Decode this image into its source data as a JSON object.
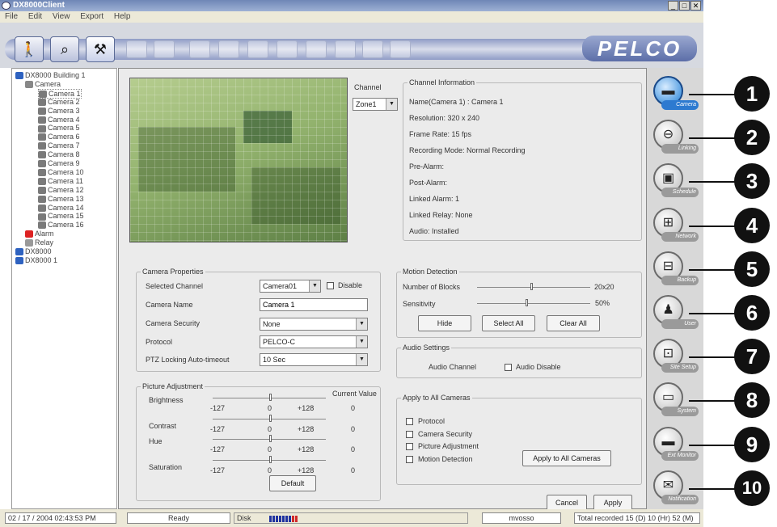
{
  "window": {
    "title": "DX8000Client"
  },
  "menu": [
    "File",
    "Edit",
    "View",
    "Export",
    "Help"
  ],
  "toolbar": {
    "logo": "PELCO",
    "buttons": [
      "person-icon",
      "search-camera-icon",
      "tools-icon"
    ]
  },
  "tree": {
    "root": "DX8000 Building 1",
    "camera_group": "Camera",
    "cameras": [
      "Camera 1",
      "Camera 2",
      "Camera 3",
      "Camera 4",
      "Camera 5",
      "Camera 6",
      "Camera 7",
      "Camera 8",
      "Camera 9",
      "Camera 10",
      "Camera 11",
      "Camera 12",
      "Camera 13",
      "Camera 14",
      "Camera 15",
      "Camera 16"
    ],
    "alarm": "Alarm",
    "relay": "Relay",
    "servers": [
      "DX8000",
      "DX8000 1"
    ]
  },
  "channel": {
    "label": "Channel",
    "value": "Zone1"
  },
  "channel_info": {
    "title": "Channel Information",
    "lines": [
      "Name(Camera  1) : Camera 1",
      "Resolution: 320 x 240",
      "Frame Rate: 15 fps",
      "Recording Mode: Normal Recording",
      "Pre-Alarm:",
      "Post-Alarm:",
      "Linked Alarm: 1",
      "Linked Relay: None",
      "Audio: Installed"
    ]
  },
  "camera_properties": {
    "title": "Camera Properties",
    "selected_channel_label": "Selected Channel",
    "selected_channel_value": "Camera01",
    "disable_label": "Disable",
    "camera_name_label": "Camera Name",
    "camera_name_value": "Camera 1",
    "camera_security_label": "Camera Security",
    "camera_security_value": "None",
    "protocol_label": "Protocol",
    "protocol_value": "PELCO-C",
    "ptz_label": "PTZ Locking Auto-timeout",
    "ptz_value": "10 Sec"
  },
  "picture_adjustment": {
    "title": "Picture Adjustment",
    "current_value_label": "Current Value",
    "default_label": "Default",
    "rows": [
      {
        "label": "Brightness",
        "min": "-127",
        "mid": "0",
        "max": "+128",
        "value": "0"
      },
      {
        "label": "Contrast",
        "min": "-127",
        "mid": "0",
        "max": "+128",
        "value": "0"
      },
      {
        "label": "Hue",
        "min": "-127",
        "mid": "0",
        "max": "+128",
        "value": "0"
      },
      {
        "label": "Saturation",
        "min": "-127",
        "mid": "0",
        "max": "+128",
        "value": "0"
      }
    ]
  },
  "motion_detection": {
    "title": "Motion Detection",
    "blocks_label": "Number of Blocks",
    "blocks_value": "20x20",
    "sensitivity_label": "Sensitivity",
    "sensitivity_value": "50%",
    "hide_label": "Hide",
    "select_all_label": "Select All",
    "clear_all_label": "Clear All"
  },
  "audio": {
    "title": "Audio Settings",
    "channel_label": "Audio Channel",
    "disable_label": "Audio Disable"
  },
  "apply_all": {
    "title": "Apply to All Cameras",
    "options": [
      "Protocol",
      "Camera Security",
      "Picture Adjustment",
      "Motion Detection"
    ],
    "button": "Apply to All Cameras"
  },
  "footer_buttons": {
    "cancel": "Cancel",
    "apply": "Apply"
  },
  "side_buttons": [
    {
      "label": "Camera",
      "icon": "camera-icon",
      "badge": "1"
    },
    {
      "label": "Linking",
      "icon": "link-icon",
      "badge": "2"
    },
    {
      "label": "Schedule",
      "icon": "schedule-icon",
      "badge": "3"
    },
    {
      "label": "Network",
      "icon": "network-icon",
      "badge": "4"
    },
    {
      "label": "Backup",
      "icon": "backup-icon",
      "badge": "5"
    },
    {
      "label": "User",
      "icon": "user-icon",
      "badge": "6"
    },
    {
      "label": "Site Setup",
      "icon": "site-setup-icon",
      "badge": "7"
    },
    {
      "label": "System",
      "icon": "system-icon",
      "badge": "8"
    },
    {
      "label": "Ext Monitor",
      "icon": "monitor-icon",
      "badge": "9"
    },
    {
      "label": "Notification",
      "icon": "notification-icon",
      "badge": "10"
    }
  ],
  "status": {
    "datetime": "02 / 17 / 2004  02:43:53 PM",
    "ready": "Ready",
    "disk_label": "Disk",
    "server": "mvosso",
    "recorded": "Total recorded 15 (D) 10 (Hr) 52 (M)"
  }
}
